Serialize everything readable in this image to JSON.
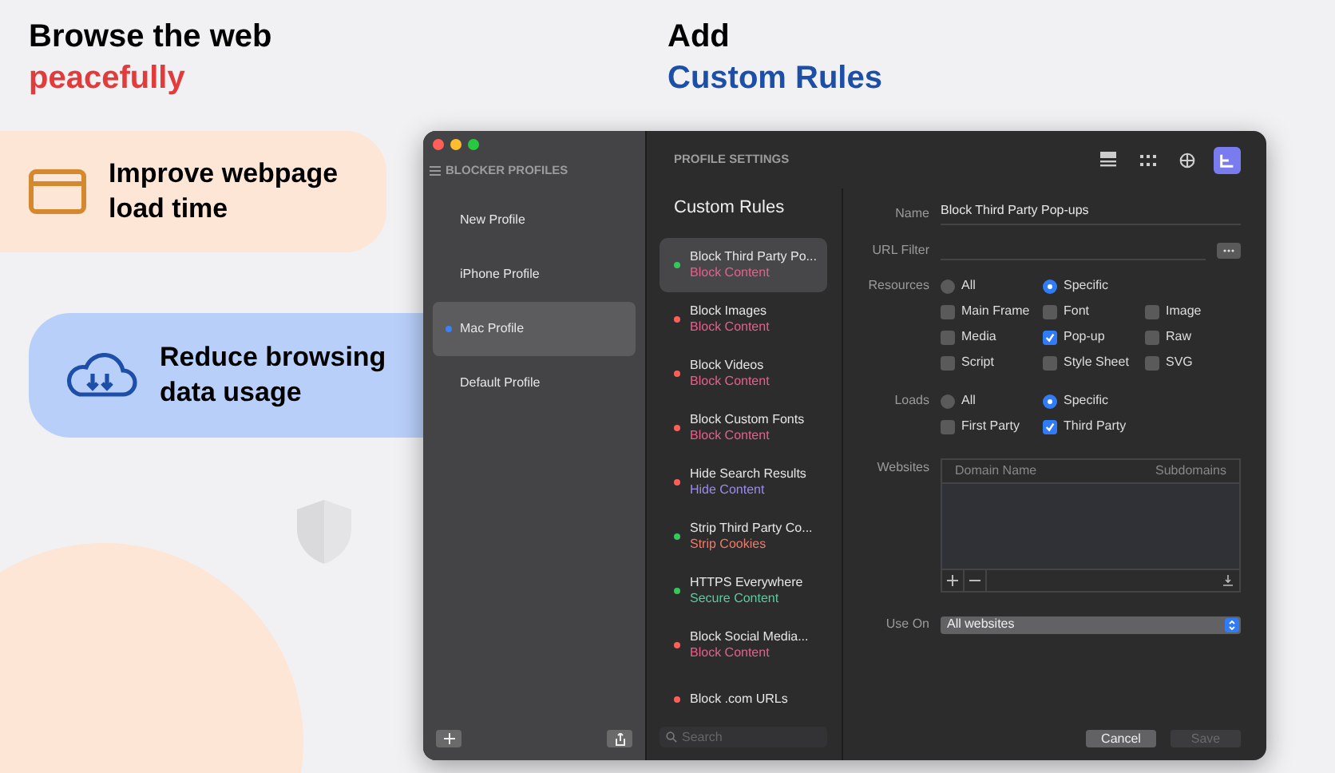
{
  "headline_left": {
    "line1": "Browse the web",
    "line2": "peacefully"
  },
  "headline_right": {
    "line1": "Add",
    "line2": "Custom Rules"
  },
  "features": [
    {
      "kind": "browser",
      "text": "Improve webpage load time"
    },
    {
      "kind": "cloud",
      "text": "Reduce browsing data usage"
    }
  ],
  "window": {
    "sidebar": {
      "title": "BLOCKER PROFILES",
      "profiles": [
        {
          "name": "New Profile",
          "selected": false
        },
        {
          "name": "iPhone Profile",
          "selected": false
        },
        {
          "name": "Mac Profile",
          "selected": true
        },
        {
          "name": "Default Profile",
          "selected": false
        }
      ]
    },
    "header": {
      "title": "PROFILE SETTINGS",
      "toolbar": [
        {
          "kind": "list",
          "selected": false
        },
        {
          "kind": "grid",
          "selected": false
        },
        {
          "kind": "globe",
          "selected": false
        },
        {
          "kind": "rules",
          "selected": true
        }
      ]
    },
    "rules_title": "Custom Rules",
    "rules": [
      {
        "name": "Block Third Party Po...",
        "category": "Block Content",
        "kind": "block",
        "color": "#34c759",
        "selected": true
      },
      {
        "name": "Block Images",
        "category": "Block Content",
        "kind": "block",
        "color": "#ff5f57",
        "selected": false
      },
      {
        "name": "Block Videos",
        "category": "Block Content",
        "kind": "block",
        "color": "#ff5f57",
        "selected": false
      },
      {
        "name": "Block Custom Fonts",
        "category": "Block Content",
        "kind": "block",
        "color": "#ff5f57",
        "selected": false
      },
      {
        "name": "Hide Search Results",
        "category": "Hide Content",
        "kind": "hide",
        "color": "#ff5f57",
        "selected": false
      },
      {
        "name": "Strip Third Party Co...",
        "category": "Strip Cookies",
        "kind": "strip",
        "color": "#34c759",
        "selected": false
      },
      {
        "name": "HTTPS Everywhere",
        "category": "Secure Content",
        "kind": "secure",
        "color": "#34c759",
        "selected": false
      },
      {
        "name": "Block Social Media...",
        "category": "Block Content",
        "kind": "block",
        "color": "#ff5f57",
        "selected": false
      },
      {
        "name": "Block .com URLs",
        "color": "#ff5f57",
        "selected": false
      }
    ],
    "search": {
      "placeholder": "Search"
    },
    "form": {
      "name": {
        "label": "Name",
        "value": "Block Third Party Pop-ups"
      },
      "url_filter": {
        "label": "URL Filter"
      },
      "resources": {
        "label": "Resources",
        "radios": [
          {
            "label": "All",
            "selected": false
          },
          {
            "label": "Specific",
            "selected": true
          }
        ],
        "checkboxes": [
          {
            "label": "Main Frame",
            "checked": false
          },
          {
            "label": "Font",
            "checked": false
          },
          {
            "label": "Image",
            "checked": false
          },
          {
            "label": "Media",
            "checked": false
          },
          {
            "label": "Pop-up",
            "checked": true
          },
          {
            "label": "Raw",
            "checked": false
          },
          {
            "label": "Script",
            "checked": false
          },
          {
            "label": "Style Sheet",
            "checked": false
          },
          {
            "label": "SVG",
            "checked": false
          }
        ]
      },
      "loads": {
        "label": "Loads",
        "radios": [
          {
            "label": "All",
            "selected": false
          },
          {
            "label": "Specific",
            "selected": true
          }
        ],
        "checkboxes": [
          {
            "label": "First Party",
            "checked": false
          },
          {
            "label": "Third Party",
            "checked": true
          }
        ]
      },
      "websites": {
        "label": "Websites",
        "columns": [
          "Domain Name",
          "Subdomains"
        ]
      },
      "use_on": {
        "label": "Use On",
        "value": "All websites"
      },
      "buttons": [
        {
          "label": "Cancel",
          "disabled": false
        },
        {
          "label": "Save",
          "disabled": true
        }
      ]
    }
  }
}
